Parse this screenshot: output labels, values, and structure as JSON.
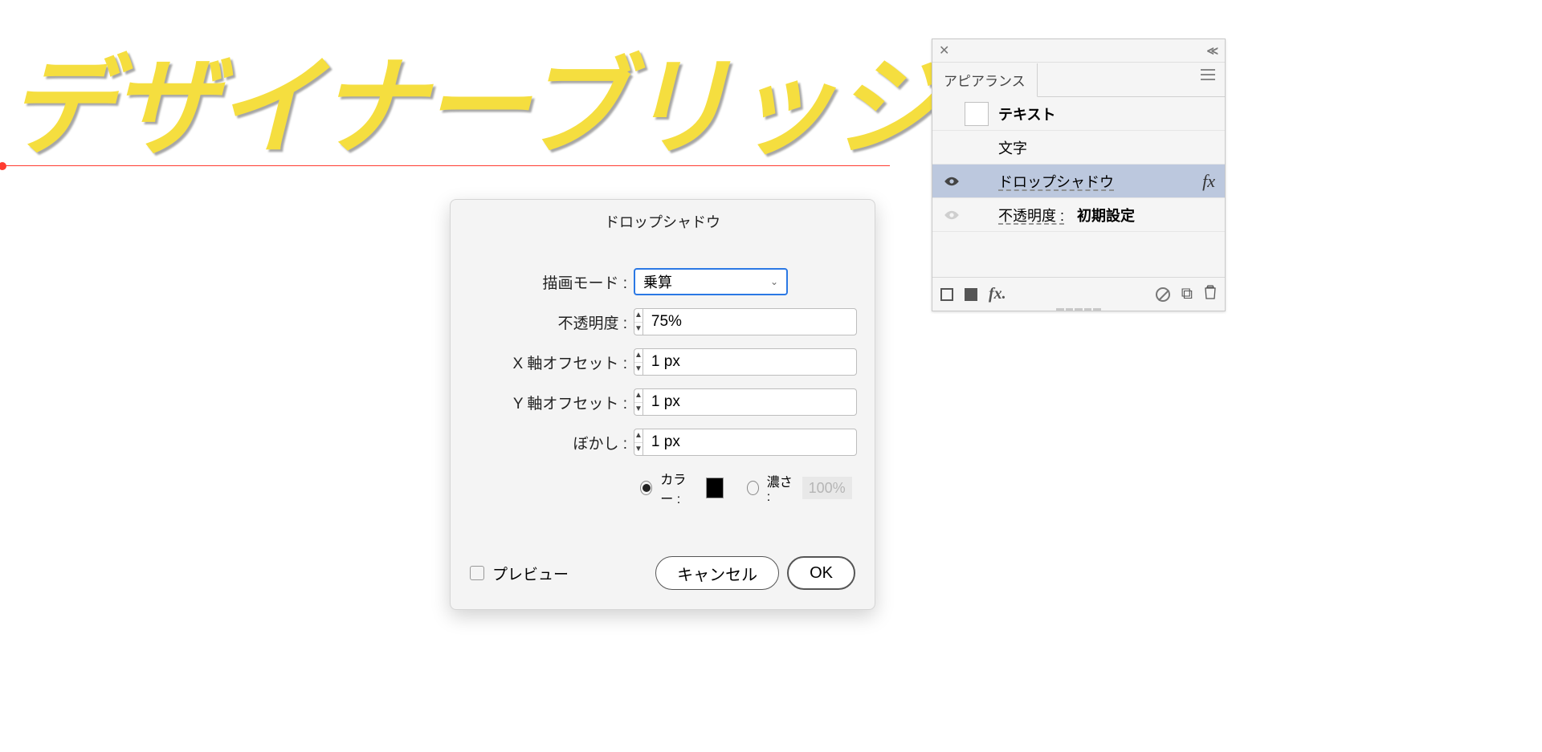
{
  "canvas": {
    "text": "デザイナーブリッジ"
  },
  "dialog": {
    "title": "ドロップシャドウ",
    "blend_label": "描画モード :",
    "blend_value": "乗算",
    "opacity_label": "不透明度 :",
    "opacity_value": "75%",
    "xoff_label": "X 軸オフセット :",
    "xoff_value": "1 px",
    "yoff_label": "Y 軸オフセット :",
    "yoff_value": "1 px",
    "blur_label": "ぼかし :",
    "blur_value": "1 px",
    "color_label": "カラー :",
    "density_label": "濃さ :",
    "density_value": "100%",
    "preview_label": "プレビュー",
    "cancel": "キャンセル",
    "ok": "OK"
  },
  "panel": {
    "tab": "アピアランス",
    "row_text": "テキスト",
    "row_char": "文字",
    "row_shadow": "ドロップシャドウ",
    "row_opacity": "不透明度 :",
    "row_opacity_val": "初期設定",
    "fx_mark": "fx",
    "footer_fx": "fx."
  }
}
